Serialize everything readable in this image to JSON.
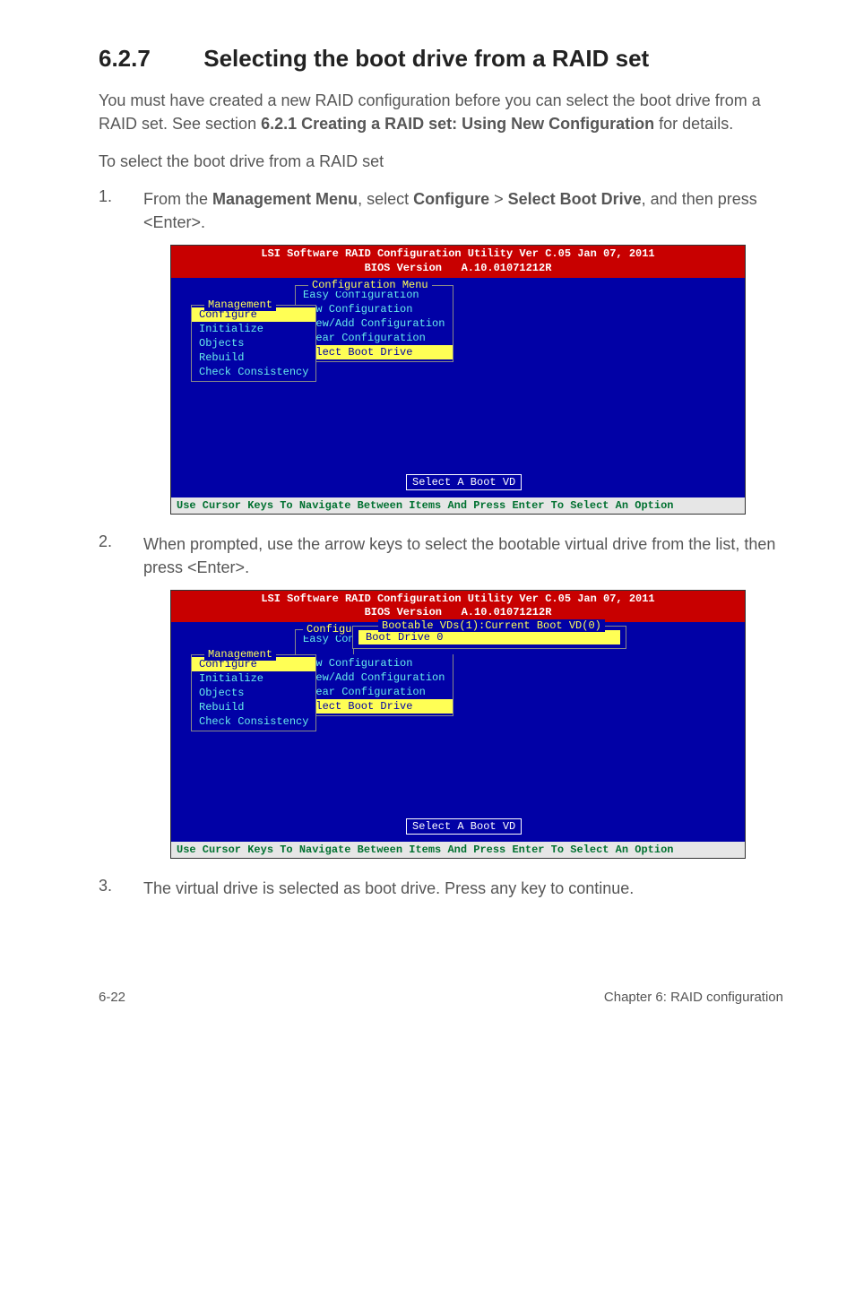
{
  "section": {
    "number": "6.2.7",
    "title": "Selecting the boot drive from a RAID set"
  },
  "intro": {
    "p1_pre": "You must have created a new RAID configuration before you can select the boot drive from a RAID set. See section ",
    "p1_bold": "6.2.1 Creating a RAID set: Using New Configuration",
    "p1_post": " for details.",
    "p2": "To select the boot drive from a RAID set"
  },
  "steps": {
    "s1": {
      "num": "1.",
      "pre": "From the ",
      "b1": "Management Menu",
      "mid1": ", select ",
      "b2": "Configure",
      "mid2": " > ",
      "b3": "Select Boot Drive",
      "post": ", and then press <Enter>."
    },
    "s2": {
      "num": "2.",
      "text": "When prompted, use the arrow keys to select the bootable virtual drive from the list, then press <Enter>."
    },
    "s3": {
      "num": "3.",
      "text": "The virtual drive is selected as boot drive. Press any key to continue."
    }
  },
  "bios": {
    "title_line1": "LSI Software RAID Configuration Utility Ver C.05 Jan 07, 2011",
    "title_line2": "BIOS Version   A.10.01071212R",
    "mgmt_title": "Management",
    "mgmt_items": {
      "configure": "Configure",
      "initialize": "Initialize",
      "objects": "Objects",
      "rebuild": "Rebuild",
      "check": "Check Consistency"
    },
    "cfg_title": "Configuration Menu",
    "cfg_items": {
      "easy": "Easy Configuration",
      "newc": "New Configuration",
      "view": "View/Add Configuration",
      "clear": "Clear Configuration",
      "selboot": "Select Boot Drive"
    },
    "select_vd": "Select A Boot VD",
    "footer": "Use Cursor Keys To Navigate Between Items And Press Enter To Select An Option"
  },
  "bios2": {
    "boot_popup_title": "Bootable VDs(1):Current Boot VD(0)",
    "boot_drive": "Boot Drive 0",
    "cfg_trunc": "Configu",
    "easy_trunc": "Easy Con"
  },
  "footer": {
    "left": "6-22",
    "right": "Chapter 6: RAID configuration"
  }
}
